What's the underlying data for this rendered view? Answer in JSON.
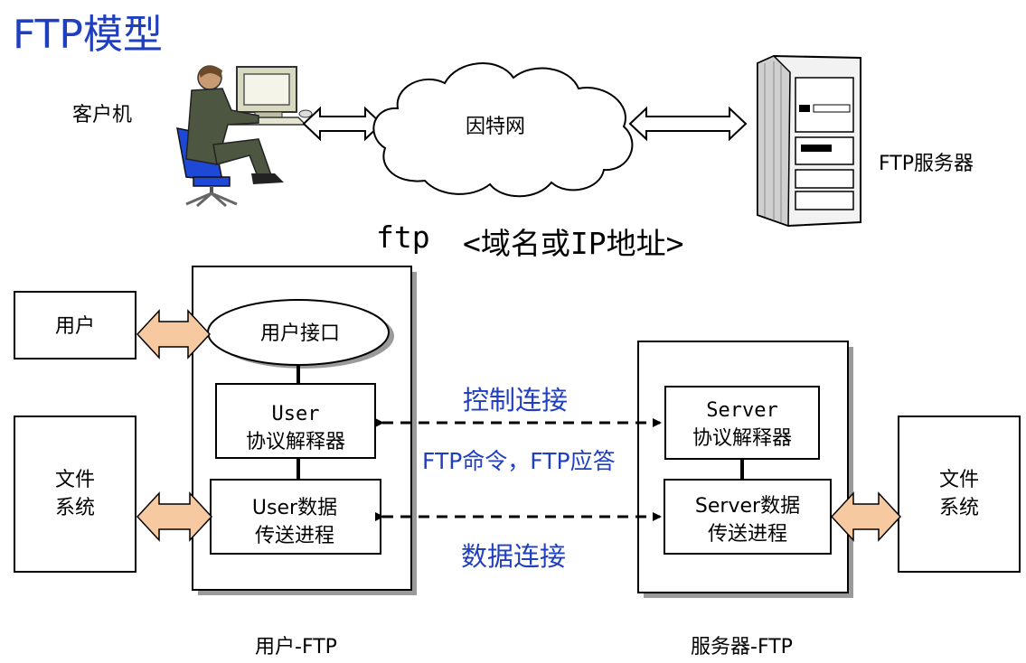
{
  "title": "FTP模型",
  "top": {
    "client_label": "客户机",
    "network_label": "因特网",
    "server_label": "FTP服务器",
    "command_prefix": "ftp",
    "command_arg": "<域名或IP地址>"
  },
  "left_side": {
    "user_box": "用户",
    "fs_line1": "文件",
    "fs_line2": "系统"
  },
  "user_ftp": {
    "interface": "用户接口",
    "pi_line1": "User",
    "pi_line2": "协议解释器",
    "dt_line1": "User数据",
    "dt_line2": "传送进程",
    "caption": "用户-FTP"
  },
  "connections": {
    "control": "控制连接",
    "commands": "FTP命令，FTP应答",
    "data": "数据连接"
  },
  "server_ftp": {
    "pi_line1": "Server",
    "pi_line2": "协议解释器",
    "dt_line1": "Server数据",
    "dt_line2": "传送进程",
    "caption": "服务器-FTP"
  },
  "right_side": {
    "fs_line1": "文件",
    "fs_line2": "系统"
  },
  "colors": {
    "title": "#000000",
    "connection_text": "#1f3fbf",
    "arrow_fill": "#f6c9a0",
    "computer_bezel": "#d9d9c0",
    "chair": "#1e49d6",
    "suit": "#4d5640"
  }
}
